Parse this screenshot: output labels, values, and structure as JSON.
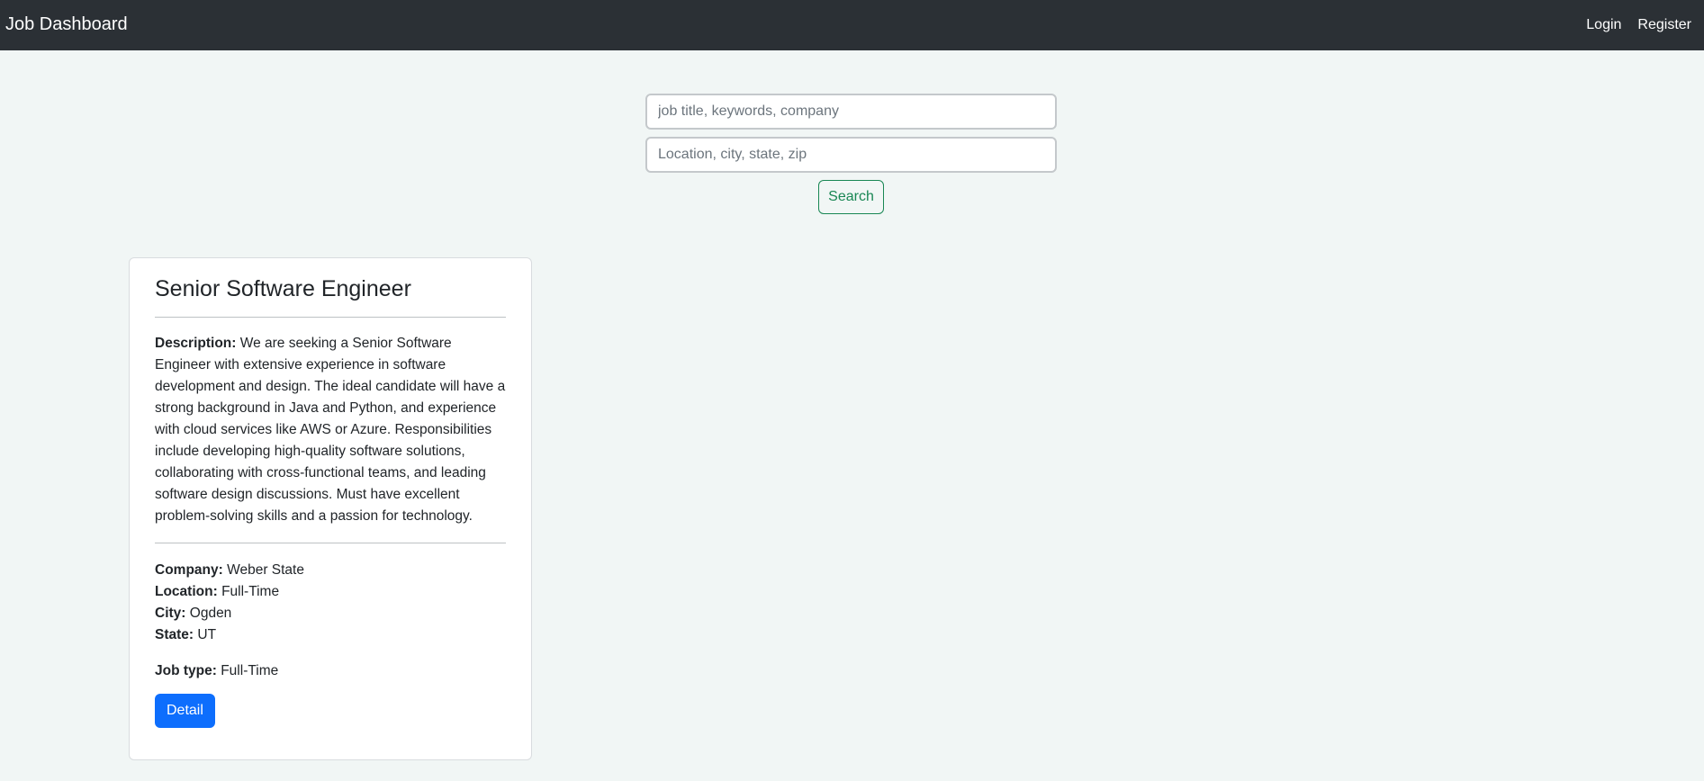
{
  "navbar": {
    "brand": "Job Dashboard",
    "login_label": "Login",
    "register_label": "Register"
  },
  "search": {
    "keywords_placeholder": "job title, keywords, company",
    "location_placeholder": "Location, city, state, zip",
    "button_label": "Search"
  },
  "job": {
    "title": "Senior Software Engineer",
    "description_label": "Description:",
    "description": "We are seeking a Senior Software Engineer with extensive experience in software development and design. The ideal candidate will have a strong background in Java and Python, and experience with cloud services like AWS or Azure. Responsibilities include developing high-quality software solutions, collaborating with cross-functional teams, and leading software design discussions. Must have excellent problem-solving skills and a passion for technology.",
    "company_label": "Company:",
    "company": "Weber State",
    "location_label": "Location:",
    "location": "Full-Time",
    "city_label": "City:",
    "city": "Ogden",
    "state_label": "State:",
    "state": "UT",
    "jobtype_label": "Job type:",
    "jobtype": "Full-Time",
    "detail_label": "Detail"
  },
  "colors": {
    "navbar_bg": "#2b3035",
    "page_bg": "#f1f6f5",
    "search_button": "#198754",
    "detail_button": "#0d6efd"
  }
}
